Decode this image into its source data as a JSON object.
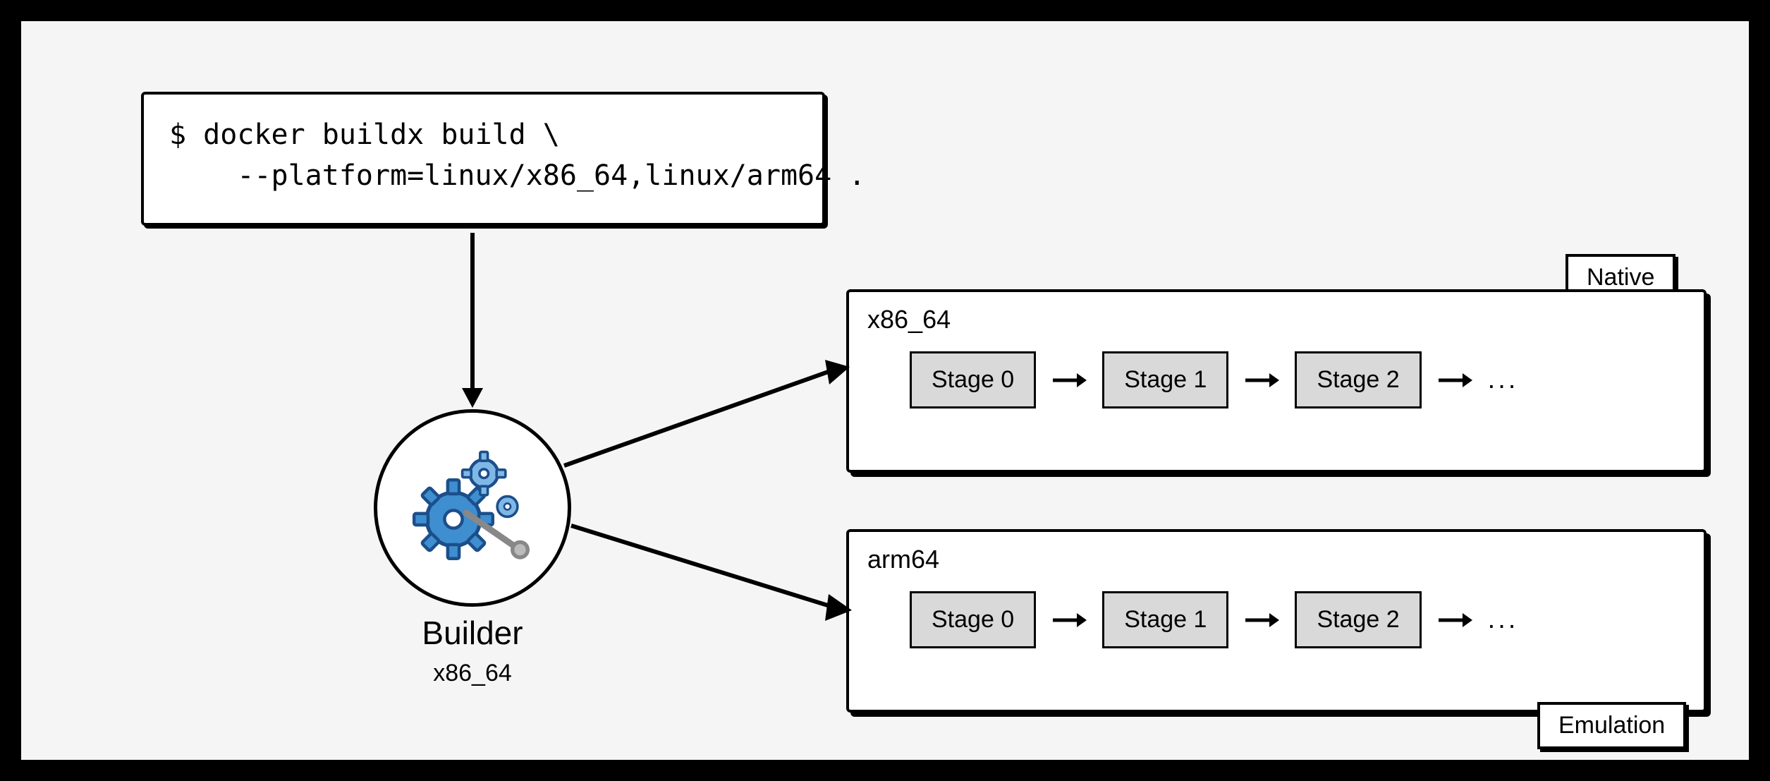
{
  "command": {
    "line1": "$ docker buildx build \\",
    "line2": "    --platform=linux/x86_64,linux/arm64 ."
  },
  "builder": {
    "label": "Builder",
    "arch": "x86_64"
  },
  "panel_x86": {
    "title": "x86_64",
    "stages": [
      "Stage 0",
      "Stage 1",
      "Stage 2"
    ],
    "trailing": "..."
  },
  "panel_arm": {
    "title": "arm64",
    "stages": [
      "Stage 0",
      "Stage 1",
      "Stage 2"
    ],
    "trailing": "..."
  },
  "tags": {
    "native": "Native",
    "emulation": "Emulation"
  }
}
